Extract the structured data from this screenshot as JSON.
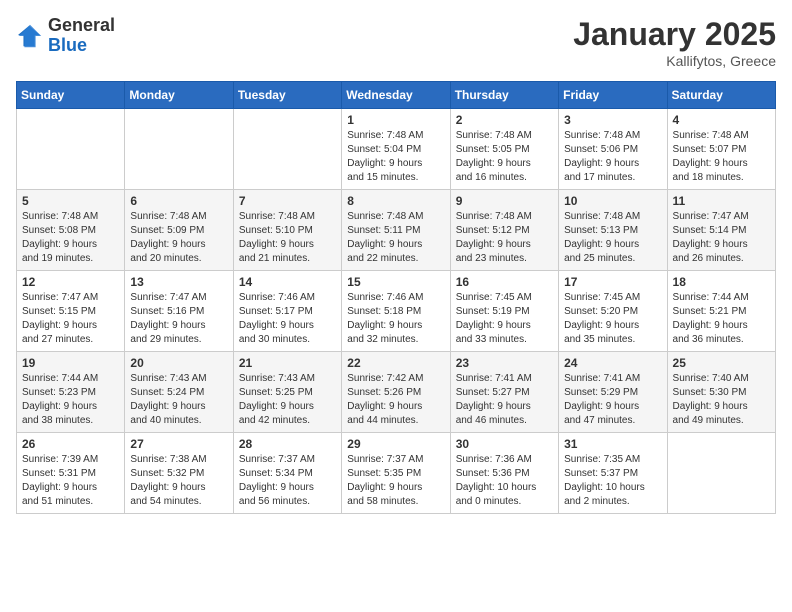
{
  "header": {
    "logo": {
      "general": "General",
      "blue": "Blue"
    },
    "title": "January 2025",
    "location": "Kallifytos, Greece"
  },
  "weekdays": [
    "Sunday",
    "Monday",
    "Tuesday",
    "Wednesday",
    "Thursday",
    "Friday",
    "Saturday"
  ],
  "weeks": [
    [
      {
        "day": "",
        "info": ""
      },
      {
        "day": "",
        "info": ""
      },
      {
        "day": "",
        "info": ""
      },
      {
        "day": "1",
        "info": "Sunrise: 7:48 AM\nSunset: 5:04 PM\nDaylight: 9 hours\nand 15 minutes."
      },
      {
        "day": "2",
        "info": "Sunrise: 7:48 AM\nSunset: 5:05 PM\nDaylight: 9 hours\nand 16 minutes."
      },
      {
        "day": "3",
        "info": "Sunrise: 7:48 AM\nSunset: 5:06 PM\nDaylight: 9 hours\nand 17 minutes."
      },
      {
        "day": "4",
        "info": "Sunrise: 7:48 AM\nSunset: 5:07 PM\nDaylight: 9 hours\nand 18 minutes."
      }
    ],
    [
      {
        "day": "5",
        "info": "Sunrise: 7:48 AM\nSunset: 5:08 PM\nDaylight: 9 hours\nand 19 minutes."
      },
      {
        "day": "6",
        "info": "Sunrise: 7:48 AM\nSunset: 5:09 PM\nDaylight: 9 hours\nand 20 minutes."
      },
      {
        "day": "7",
        "info": "Sunrise: 7:48 AM\nSunset: 5:10 PM\nDaylight: 9 hours\nand 21 minutes."
      },
      {
        "day": "8",
        "info": "Sunrise: 7:48 AM\nSunset: 5:11 PM\nDaylight: 9 hours\nand 22 minutes."
      },
      {
        "day": "9",
        "info": "Sunrise: 7:48 AM\nSunset: 5:12 PM\nDaylight: 9 hours\nand 23 minutes."
      },
      {
        "day": "10",
        "info": "Sunrise: 7:48 AM\nSunset: 5:13 PM\nDaylight: 9 hours\nand 25 minutes."
      },
      {
        "day": "11",
        "info": "Sunrise: 7:47 AM\nSunset: 5:14 PM\nDaylight: 9 hours\nand 26 minutes."
      }
    ],
    [
      {
        "day": "12",
        "info": "Sunrise: 7:47 AM\nSunset: 5:15 PM\nDaylight: 9 hours\nand 27 minutes."
      },
      {
        "day": "13",
        "info": "Sunrise: 7:47 AM\nSunset: 5:16 PM\nDaylight: 9 hours\nand 29 minutes."
      },
      {
        "day": "14",
        "info": "Sunrise: 7:46 AM\nSunset: 5:17 PM\nDaylight: 9 hours\nand 30 minutes."
      },
      {
        "day": "15",
        "info": "Sunrise: 7:46 AM\nSunset: 5:18 PM\nDaylight: 9 hours\nand 32 minutes."
      },
      {
        "day": "16",
        "info": "Sunrise: 7:45 AM\nSunset: 5:19 PM\nDaylight: 9 hours\nand 33 minutes."
      },
      {
        "day": "17",
        "info": "Sunrise: 7:45 AM\nSunset: 5:20 PM\nDaylight: 9 hours\nand 35 minutes."
      },
      {
        "day": "18",
        "info": "Sunrise: 7:44 AM\nSunset: 5:21 PM\nDaylight: 9 hours\nand 36 minutes."
      }
    ],
    [
      {
        "day": "19",
        "info": "Sunrise: 7:44 AM\nSunset: 5:23 PM\nDaylight: 9 hours\nand 38 minutes."
      },
      {
        "day": "20",
        "info": "Sunrise: 7:43 AM\nSunset: 5:24 PM\nDaylight: 9 hours\nand 40 minutes."
      },
      {
        "day": "21",
        "info": "Sunrise: 7:43 AM\nSunset: 5:25 PM\nDaylight: 9 hours\nand 42 minutes."
      },
      {
        "day": "22",
        "info": "Sunrise: 7:42 AM\nSunset: 5:26 PM\nDaylight: 9 hours\nand 44 minutes."
      },
      {
        "day": "23",
        "info": "Sunrise: 7:41 AM\nSunset: 5:27 PM\nDaylight: 9 hours\nand 46 minutes."
      },
      {
        "day": "24",
        "info": "Sunrise: 7:41 AM\nSunset: 5:29 PM\nDaylight: 9 hours\nand 47 minutes."
      },
      {
        "day": "25",
        "info": "Sunrise: 7:40 AM\nSunset: 5:30 PM\nDaylight: 9 hours\nand 49 minutes."
      }
    ],
    [
      {
        "day": "26",
        "info": "Sunrise: 7:39 AM\nSunset: 5:31 PM\nDaylight: 9 hours\nand 51 minutes."
      },
      {
        "day": "27",
        "info": "Sunrise: 7:38 AM\nSunset: 5:32 PM\nDaylight: 9 hours\nand 54 minutes."
      },
      {
        "day": "28",
        "info": "Sunrise: 7:37 AM\nSunset: 5:34 PM\nDaylight: 9 hours\nand 56 minutes."
      },
      {
        "day": "29",
        "info": "Sunrise: 7:37 AM\nSunset: 5:35 PM\nDaylight: 9 hours\nand 58 minutes."
      },
      {
        "day": "30",
        "info": "Sunrise: 7:36 AM\nSunset: 5:36 PM\nDaylight: 10 hours\nand 0 minutes."
      },
      {
        "day": "31",
        "info": "Sunrise: 7:35 AM\nSunset: 5:37 PM\nDaylight: 10 hours\nand 2 minutes."
      },
      {
        "day": "",
        "info": ""
      }
    ]
  ]
}
